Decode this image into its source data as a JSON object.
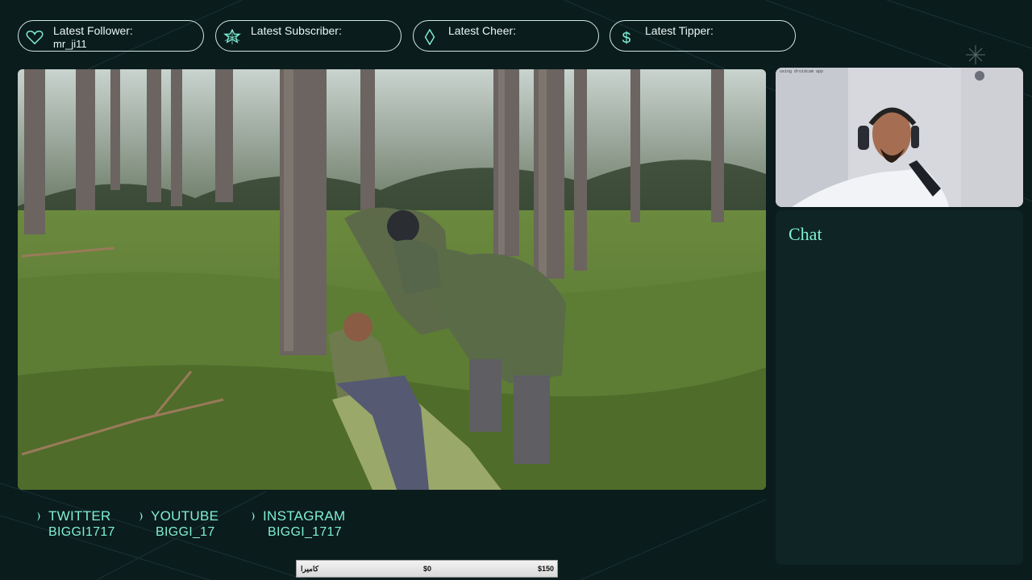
{
  "alerts": [
    {
      "label": "Latest Follower:",
      "value": "mr_ji11",
      "icon": "heart-icon"
    },
    {
      "label": "Latest Subscriber:",
      "value": "",
      "icon": "star-icon"
    },
    {
      "label": "Latest Cheer:",
      "value": "",
      "icon": "diamond-icon"
    },
    {
      "label": "Latest Tipper:",
      "value": "",
      "icon": "dollar-icon"
    }
  ],
  "webcam": {
    "caption": "using droidcam app"
  },
  "chat": {
    "title": "Chat"
  },
  "socials": [
    {
      "name": "TWITTER",
      "handle": "BIGGI1717",
      "icon": "moon-icon"
    },
    {
      "name": "YOUTUBE",
      "handle": "BIGGI_17",
      "icon": "moon-icon"
    },
    {
      "name": "INSTAGRAM",
      "handle": "BIGGI_1717",
      "icon": "moon-icon"
    }
  ],
  "goal": {
    "label": "کامیرا",
    "start": "$0",
    "target": "$150"
  },
  "colors": {
    "accent": "#7ff0d6",
    "background": "#0b1c1d",
    "border": "#cfe8e2",
    "panel": "#0f2424"
  }
}
